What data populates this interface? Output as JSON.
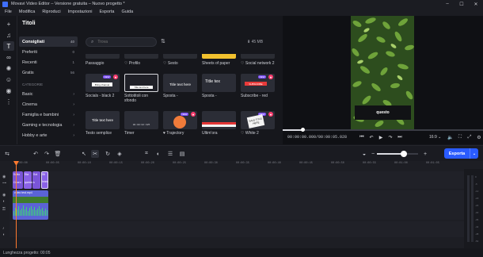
{
  "titlebar": {
    "title": "Movavi Video Editor – Versione gratuita – Nuovo progetto *"
  },
  "menu": [
    "File",
    "Modifica",
    "Riproduci",
    "Impostazioni",
    "Esporta",
    "Guida"
  ],
  "panel": {
    "title": "Titoli",
    "search_placeholder": "Trova",
    "storage": "45 MB",
    "categories": [
      {
        "label": "Consigliati",
        "count": "40"
      },
      {
        "label": "Preferiti",
        "count": "0"
      },
      {
        "label": "Recenti",
        "count": "1"
      },
      {
        "label": "Gratis",
        "count": "56"
      }
    ],
    "section_label": "CATEGORIE",
    "category_groups": [
      "Basic",
      "Cinema",
      "Famiglia e bambini",
      "Gaming e tecnologia",
      "Hobby e arte"
    ],
    "row1_labels": [
      "Passaggio",
      "Profilo",
      "Sesto",
      "Sheets of paper",
      "Social network 2"
    ],
    "tiles": [
      {
        "label": "Socials - black 2",
        "badge": "NEW",
        "thumb_text": "Bring channel"
      },
      {
        "label": "Sottotitoli con sfondo",
        "badge": "",
        "thumb_text": "Title text here"
      },
      {
        "label": "Sposta -",
        "badge": "",
        "thumb_text": "Title text here"
      },
      {
        "label": "Sposta -",
        "badge": "",
        "thumb_text": "Title tex"
      },
      {
        "label": "Subscribe - red",
        "badge": "NEW",
        "thumb_text": "SUBSCRIBE"
      },
      {
        "label": "Testo semplice",
        "badge": "",
        "thumb_text": "Title text here"
      },
      {
        "label": "Timer",
        "badge": "",
        "thumb_text": "00:00:02:325"
      },
      {
        "label": "Trajectory",
        "badge": "NEW",
        "thumb_text": ""
      },
      {
        "label": "Ultim'ora",
        "badge": "",
        "thumb_text": ""
      },
      {
        "label": "White 2",
        "badge": "NEW",
        "thumb_text": "SALE TITLE HERE"
      }
    ]
  },
  "preview": {
    "overlay_text": "questo",
    "timecode": "00:00:00.000/00:00:05.028",
    "progress_fraction": 0.1,
    "aspect_ratio": "16:9"
  },
  "toolbar": {
    "export_label": "Esporta",
    "zoom_fraction": 0.65
  },
  "timeline": {
    "ruler": [
      "00:00:00",
      "00:00:05",
      "00:00:10",
      "00:00:15",
      "00:00:20",
      "00:00:25",
      "00:00:30",
      "00:00:35",
      "00:00:40",
      "00:00:45",
      "00:00:50",
      "00:00:55",
      "00:01:00",
      "00:01:05"
    ],
    "title_clips": [
      "Sotto",
      "Sta",
      "Sot",
      "Sti"
    ],
    "title_clips_row2": [
      "Cuoro",
      "questo",
      "s",
      "Inizio"
    ],
    "video_clip_label": "video test.mp4",
    "meter_labels": [
      "0",
      "-6",
      "-12",
      "-18",
      "-24",
      "-30",
      "-36",
      "-42",
      "-48",
      "-54"
    ]
  },
  "status": {
    "project_length": "Lunghezza progetto: 00:05"
  },
  "colors": {
    "accent": "#2a5bff",
    "playhead": "#ff7a2f",
    "title_clip": "#7a55d8",
    "video_clip": "#5b63d6"
  }
}
